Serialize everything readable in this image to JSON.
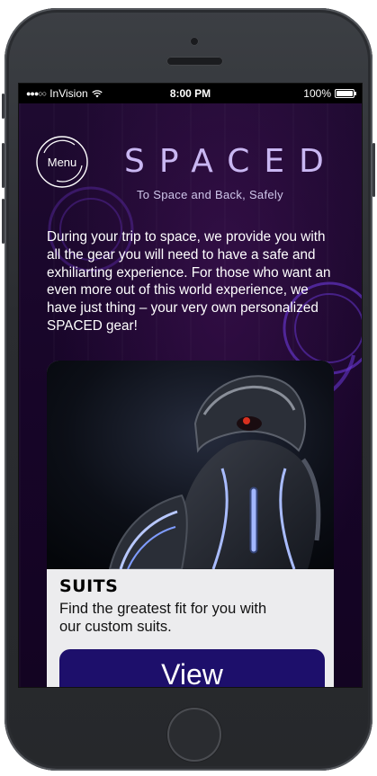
{
  "status_bar": {
    "carrier": "InVision",
    "time": "8:00 PM",
    "battery": "100%"
  },
  "header": {
    "menu_label": "Menu",
    "brand": "SPACED",
    "tagline": "To Space and Back, Safely"
  },
  "intro": "During your trip to space, we provide you with all the gear you will need to have a safe and exhiliarting experience. For those who want an even more out of this world experience, we have just thing – your very own personalized SPACED gear!",
  "card": {
    "title": "SUITS",
    "description": "Find the greatest fit for you with our custom suits.",
    "button_label": "View"
  },
  "colors": {
    "background": "#170528",
    "accent": "#7a4fe0",
    "button": "#1d0f6b",
    "card": "#ececee"
  }
}
